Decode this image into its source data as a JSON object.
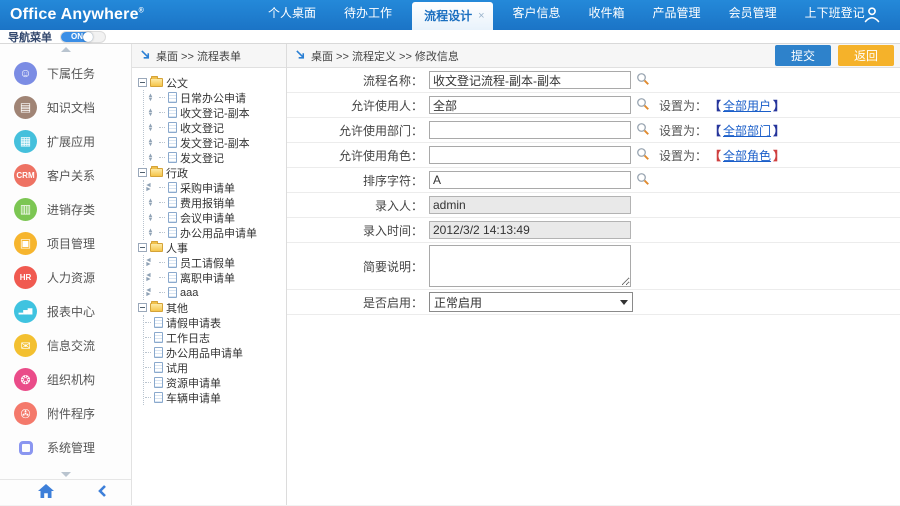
{
  "brand": {
    "name": "Office Anywhere",
    "reg": "®"
  },
  "topnav": {
    "close_glyph": "×",
    "items": [
      {
        "label": "个人桌面"
      },
      {
        "label": "待办工作"
      },
      {
        "label": "流程设计"
      },
      {
        "label": "客户信息"
      },
      {
        "label": "收件箱"
      },
      {
        "label": "产品管理"
      },
      {
        "label": "会员管理"
      },
      {
        "label": "上下班登记"
      }
    ]
  },
  "navmenu": {
    "label": "导航菜单",
    "toggle_state": "ON"
  },
  "sidebar": {
    "items": [
      {
        "label": "下属任务",
        "glyph": "☺",
        "color": "#7b8ce4",
        "icon": "subordinate-tasks"
      },
      {
        "label": "知识文档",
        "glyph": "▤",
        "color": "#a08475",
        "icon": "knowledge-docs"
      },
      {
        "label": "扩展应用",
        "glyph": "▦",
        "color": "#45c0dc",
        "icon": "extended-apps"
      },
      {
        "label": "客户关系",
        "glyph": "CRM",
        "color": "#ee7263",
        "icon": "crm"
      },
      {
        "label": "进销存类",
        "glyph": "▥",
        "color": "#7cc653",
        "icon": "inventory"
      },
      {
        "label": "项目管理",
        "glyph": "▣",
        "color": "#f6b52e",
        "icon": "project-management"
      },
      {
        "label": "人力资源",
        "glyph": "HR",
        "color": "#f05a50",
        "icon": "human-resources"
      },
      {
        "label": "报表中心",
        "glyph": "▂▅▇",
        "color": "#3fc3e0",
        "icon": "report-center"
      },
      {
        "label": "信息交流",
        "glyph": "✉",
        "color": "#f3c030",
        "icon": "messaging"
      },
      {
        "label": "组织机构",
        "glyph": "❂",
        "color": "#ea4c89",
        "icon": "organization"
      },
      {
        "label": "附件程序",
        "glyph": "✇",
        "color": "#f4796b",
        "icon": "attachments"
      },
      {
        "label": "系统管理",
        "glyph": "",
        "color": "#8a96f0",
        "icon": "system-management"
      }
    ]
  },
  "tree": {
    "breadcrumb": "桌面 >> 流程表单",
    "groups": [
      {
        "label": "公文",
        "items": [
          {
            "label": "日常办公申请"
          },
          {
            "label": "收文登记-副本"
          },
          {
            "label": "收文登记"
          },
          {
            "label": "发文登记-副本"
          },
          {
            "label": "发文登记"
          }
        ]
      },
      {
        "label": "行政",
        "items": [
          {
            "label": "采购申请单"
          },
          {
            "label": "费用报销单"
          },
          {
            "label": "会议申请单"
          },
          {
            "label": "办公用品申请单"
          }
        ]
      },
      {
        "label": "人事",
        "items": [
          {
            "label": "员工请假单"
          },
          {
            "label": "离职申请单"
          },
          {
            "label": "aaa"
          }
        ]
      },
      {
        "label": "其他",
        "items": [
          {
            "label": "请假申请表"
          },
          {
            "label": "工作日志"
          },
          {
            "label": "办公用品申请单"
          },
          {
            "label": "试用"
          },
          {
            "label": "资源申请单"
          },
          {
            "label": "车辆申请单"
          }
        ]
      }
    ]
  },
  "panel": {
    "breadcrumb": "桌面 >> 流程定义 >> 修改信息",
    "submit_label": "提交",
    "back_label": "返回"
  },
  "form": {
    "rows": [
      {
        "label": "流程名称：",
        "value": "收文登记流程-副本-副本"
      },
      {
        "label": "允许使用人：",
        "value": "全部",
        "set_prefix": "设置为：",
        "bl": "【",
        "link": "全部用户",
        "br": "】"
      },
      {
        "label": "允许使用部门：",
        "value": "",
        "set_prefix": "设置为：",
        "bl": "【",
        "link": "全部部门",
        "br": "】"
      },
      {
        "label": "允许使用角色：",
        "value": "",
        "set_prefix": "设置为：",
        "bl": "【",
        "link": "全部角色",
        "br": "】"
      },
      {
        "label": "排序字符：",
        "value": "A"
      },
      {
        "label": "录入人：",
        "value": "admin"
      },
      {
        "label": "录入时间：",
        "value": "2012/3/2 14:13:49"
      },
      {
        "label": "简要说明：",
        "value": ""
      },
      {
        "label": "是否启用：",
        "value": "正常启用"
      }
    ],
    "colors": {
      "bracket_default": "#26359b",
      "bracket_role": "#cf4040",
      "link": "#1a5ec9"
    }
  }
}
